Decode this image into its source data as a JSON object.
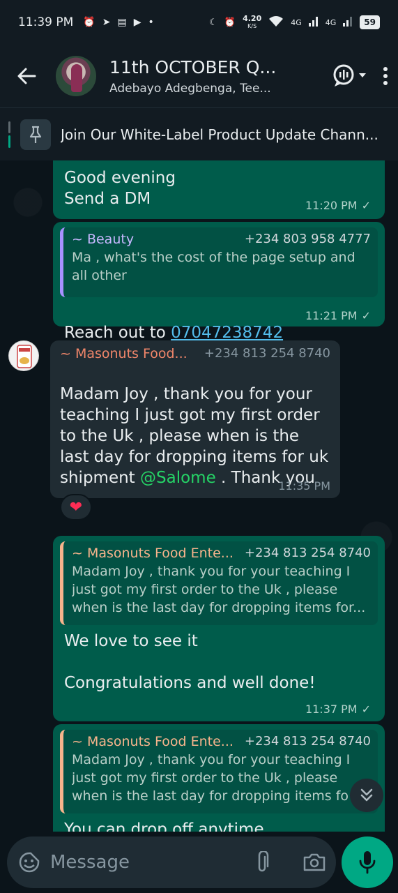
{
  "status_bar": {
    "time": "11:39 PM",
    "net_speed": "4.20",
    "net_unit": "K/S",
    "signal1": "4G",
    "signal2": "4G",
    "battery": "59"
  },
  "header": {
    "title": "11th OCTOBER Q...",
    "subtitle": "Adebayo Adegbenga, Tee..."
  },
  "pinned": {
    "text": "Join Our White-Label Product Update Chann..."
  },
  "messages": [
    {
      "text": "Good evening\nSend a DM",
      "time": "11:20 PM"
    },
    {
      "quote_name": "~ Beauty",
      "quote_phone": "+234 803 958 4777",
      "quote_text": "Ma , what's the cost of the page setup and all other",
      "text_prefix": "Reach out to ",
      "link": "07047238742",
      "time": "11:21 PM"
    },
    {
      "sender": "~ Masonuts Food...",
      "sender_phone": "+234 813 254 8740",
      "text_before": "Madam Joy , thank you for your teaching I just got my first order to the Uk , please when is the last day for dropping items for uk shipment ",
      "mention": "@Salome",
      "text_after": " . Thank you",
      "time": "11:35 PM",
      "reaction": "❤"
    },
    {
      "quote_name": "~ Masonuts Food Ente...",
      "quote_phone": "+234 813 254 8740",
      "quote_text": "Madam Joy , thank you for your teaching I just got my first order to the Uk , please when is the last day for dropping items for...",
      "text": "We love to see it\n\nCongratulations and well done!",
      "time": "11:37 PM"
    },
    {
      "quote_name": "~ Masonuts Food Ente...",
      "quote_phone": "+234 813 254 8740",
      "quote_text": "Madam Joy , thank you for your teaching I just got my first order to the Uk , please when is the last day for dropping items fo",
      "text": "You can drop off anytime"
    }
  ],
  "input": {
    "placeholder": "Message"
  },
  "colors": {
    "outgoing_bubble": "#005c4b",
    "incoming_bubble": "#202c33",
    "accent": "#00a884",
    "beauty_quote": "#a791ff",
    "masonuts_name": "#f0866a",
    "masonuts_quote": "#f7b48c"
  }
}
